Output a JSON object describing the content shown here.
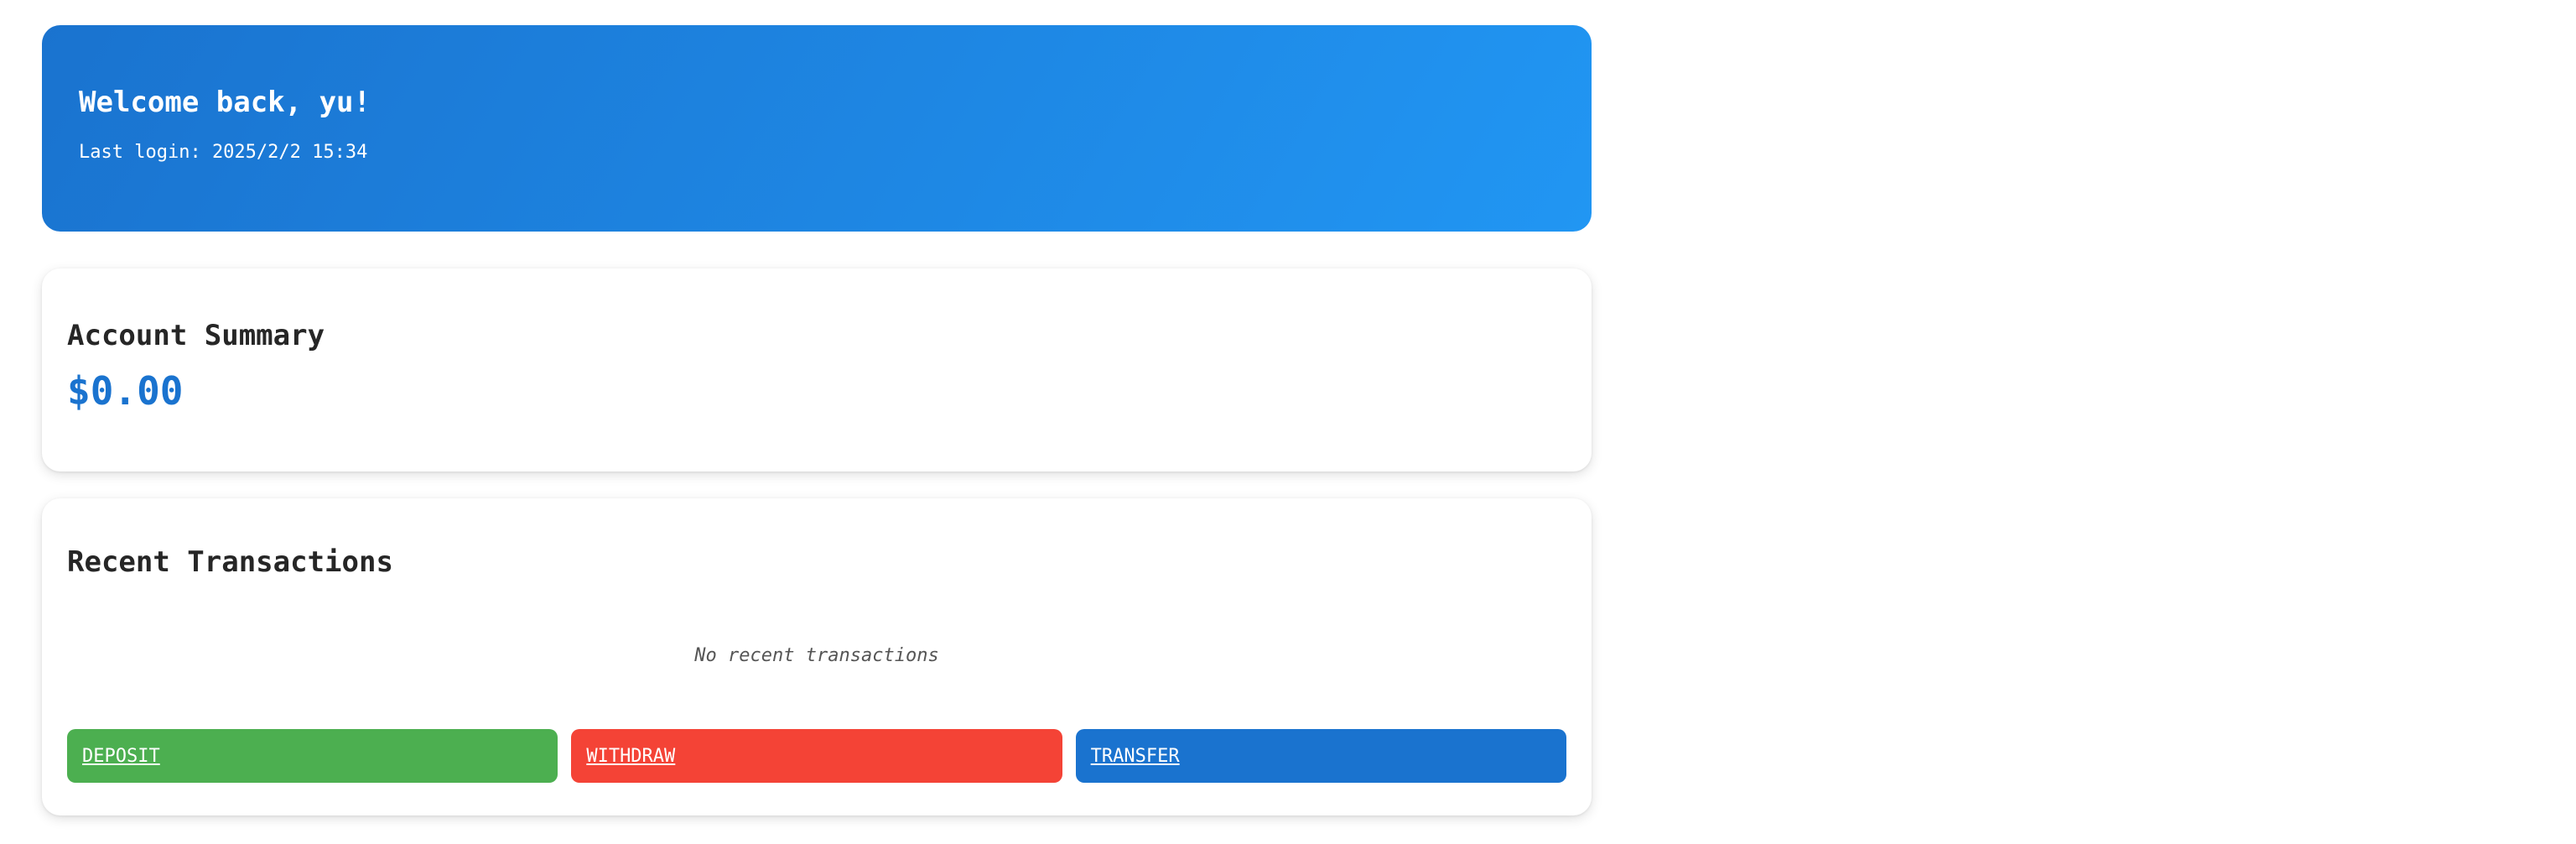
{
  "header": {
    "welcome": "Welcome back, yu!",
    "last_login": "Last login: 2025/2/2 15:34"
  },
  "summary": {
    "title": "Account Summary",
    "balance": "$0.00"
  },
  "transactions": {
    "title": "Recent Transactions",
    "empty_text": "No recent transactions"
  },
  "actions": {
    "deposit": "DEPOSIT",
    "withdraw": "WITHDRAW",
    "transfer": "TRANSFER"
  },
  "colors": {
    "primary": "#1a73cf",
    "deposit": "#4caf50",
    "withdraw": "#f44336"
  }
}
